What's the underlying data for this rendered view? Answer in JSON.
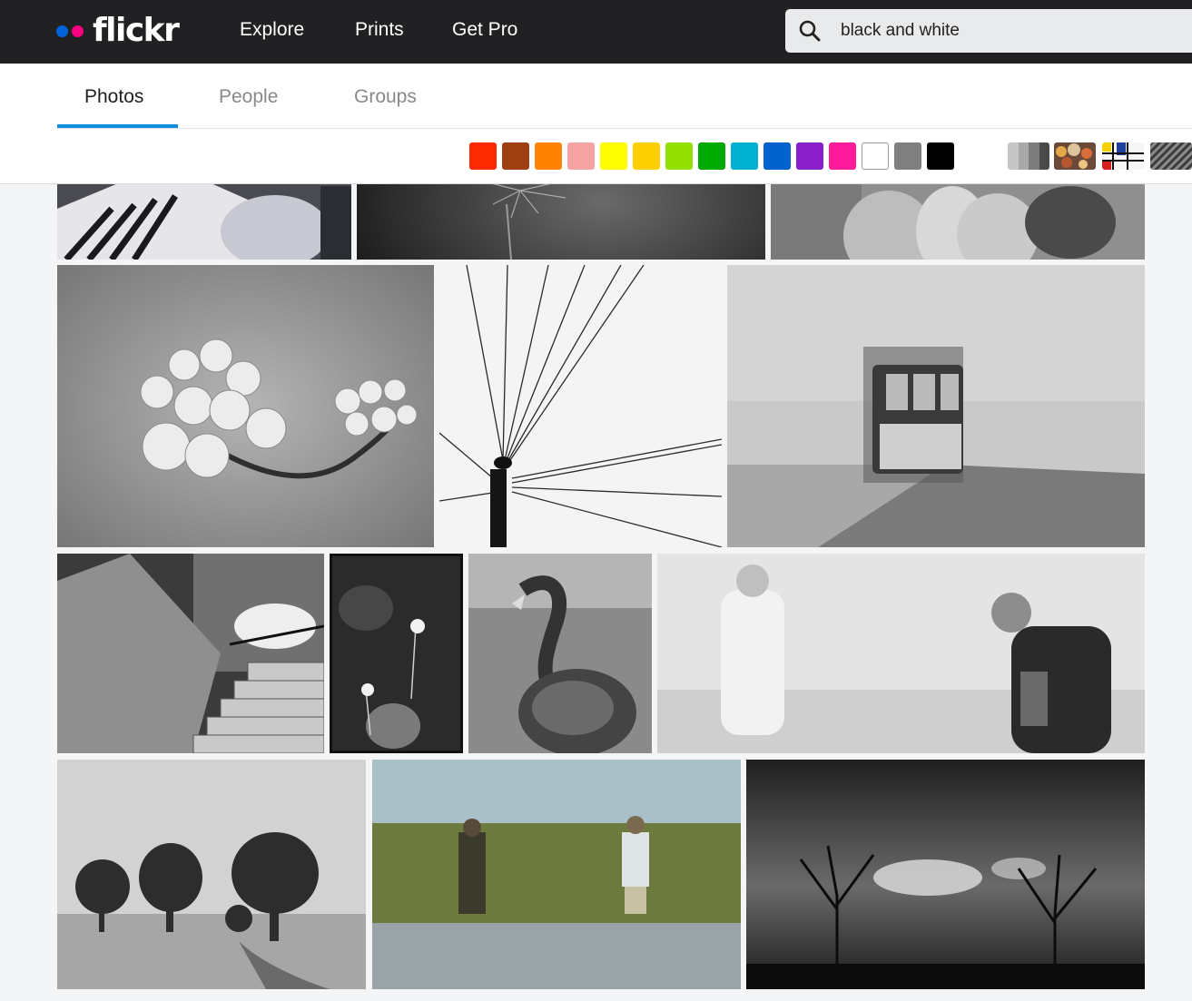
{
  "brand": {
    "name": "flickr",
    "dot_colors": [
      "#0063dc",
      "#ff0084"
    ]
  },
  "nav": {
    "links": [
      "Explore",
      "Prints",
      "Get Pro"
    ]
  },
  "search": {
    "query": "black and white",
    "icon": "search-icon"
  },
  "tabs": [
    {
      "label": "Photos",
      "active": true
    },
    {
      "label": "People",
      "active": false
    },
    {
      "label": "Groups",
      "active": false
    }
  ],
  "color_filters": [
    "#ff2a00",
    "#9e4012",
    "#ff8200",
    "#f7a3a3",
    "#ffff00",
    "#ffd000",
    "#93e000",
    "#00a900",
    "#00b2d2",
    "#0062cc",
    "#8a1fcc",
    "#ff1b9c",
    "#ffffff",
    "#808080",
    "#000000"
  ],
  "style_filters": [
    "black-and-white",
    "shallow-depth-of-field",
    "minimalist",
    "patterns"
  ],
  "accent_color": "#128fdc",
  "photos": [
    "striped-legs-bw",
    "dandelion-dark-bw",
    "tattooed-figures-bw",
    "cherry-blossom-bw",
    "bird-on-wires-bw",
    "lisbon-tram-motion-bw",
    "concrete-stairs-bw",
    "daisies-dark-bw",
    "swan-bw",
    "woman-in-smoke-bw",
    "winter-trees-bw",
    "water-reflection-color",
    "stormy-sky-trees-bw"
  ]
}
